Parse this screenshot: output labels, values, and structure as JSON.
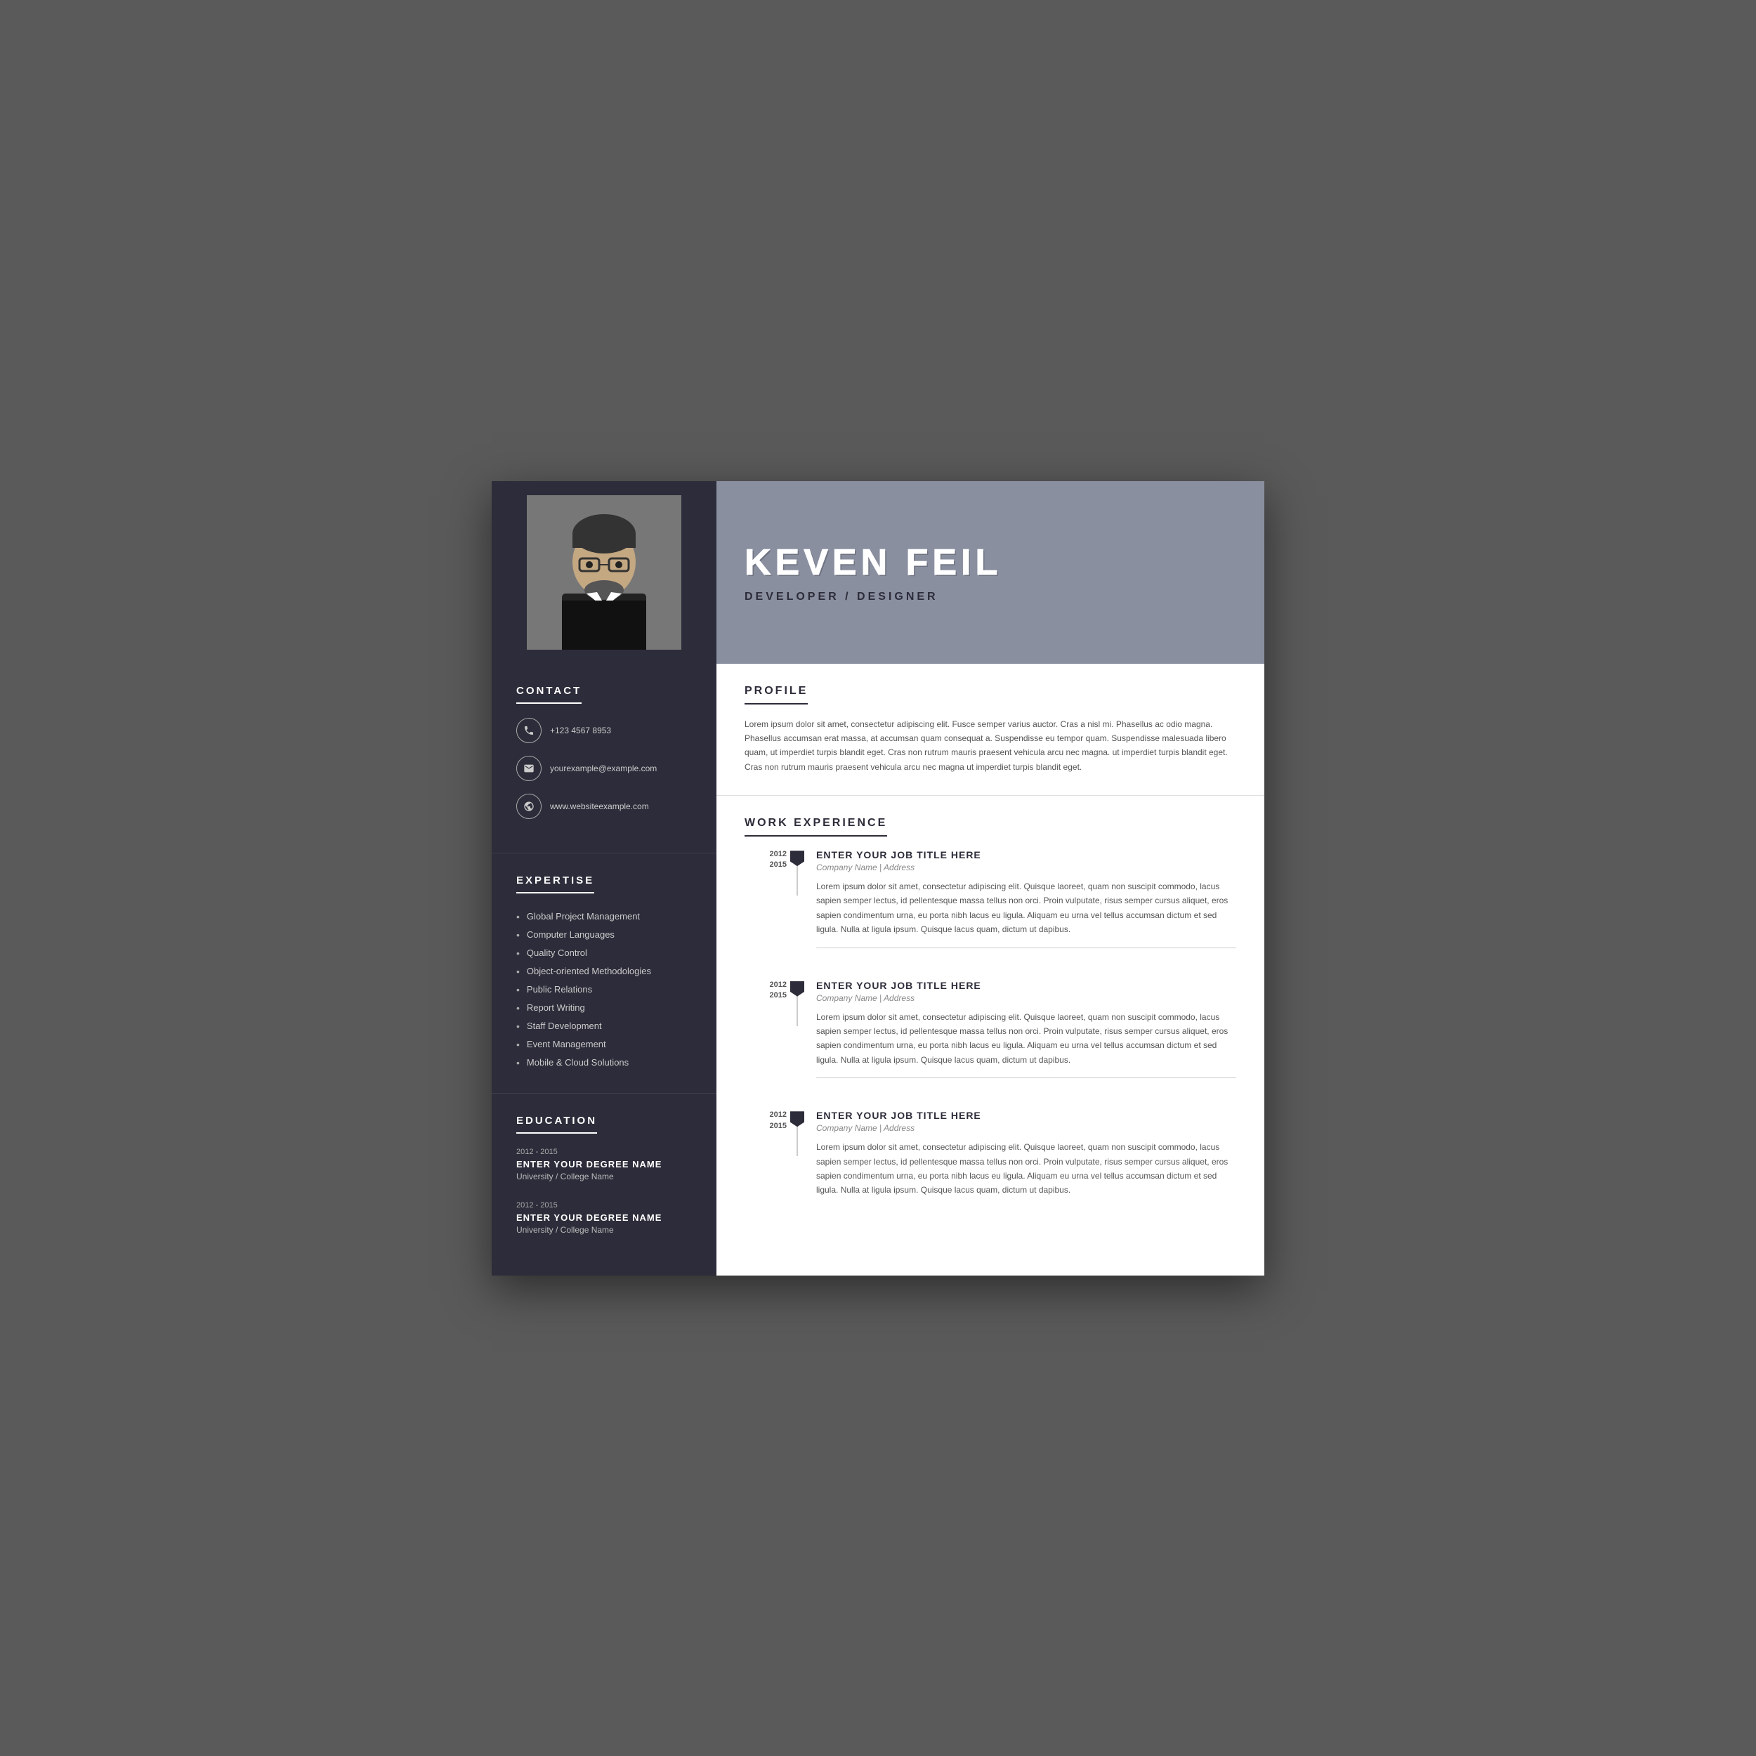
{
  "header": {
    "name": "KEVEN  FEIL",
    "title": "DEVELOPER / DESIGNER"
  },
  "contact": {
    "section_title": "CONTACT",
    "phone": "+123 4567 8953",
    "email": "yourexample@example.com",
    "website": "www.websiteexample.com"
  },
  "expertise": {
    "section_title": "EXPERTISE",
    "items": [
      "Global Project Management",
      "Computer Languages",
      "Quality Control",
      "Object-oriented Methodologies",
      "Public Relations",
      "Report Writing",
      "Staff Development",
      "Event Management",
      "Mobile & Cloud Solutions"
    ]
  },
  "education": {
    "section_title": "EDUCATION",
    "entries": [
      {
        "years": "2012 - 2015",
        "degree": "ENTER YOUR DEGREE NAME",
        "university": "University / College Name"
      },
      {
        "years": "2012 - 2015",
        "degree": "ENTER YOUR DEGREE NAME",
        "university": "University / College Name"
      }
    ]
  },
  "profile": {
    "section_title": "PROFILE",
    "text": "Lorem ipsum dolor sit amet, consectetur adipiscing elit. Fusce semper varius auctor. Cras a nisl mi. Phasellus ac odio magna. Phasellus accumsan erat massa, at accumsan quam consequat a. Suspendisse eu tempor quam. Suspendisse malesuada libero quam, ut imperdiet turpis blandit eget. Cras non rutrum mauris praesent vehicula arcu nec magna. ut imperdiet turpis blandit eget. Cras non rutrum mauris praesent vehicula arcu nec magna ut imperdiet turpis blandit eget."
  },
  "work_experience": {
    "section_title": "WORK EXPERIENCE",
    "jobs": [
      {
        "year_start": "2012",
        "year_end": "2015",
        "title": "ENTER YOUR JOB TITLE HERE",
        "company": "Company Name | Address",
        "description": "Lorem ipsum dolor sit amet, consectetur adipiscing elit. Quisque laoreet, quam non suscipit commodo, lacus sapien semper lectus, id pellentesque massa tellus non orci. Proin vulputate, risus semper cursus aliquet, eros sapien condimentum urna, eu porta nibh lacus eu ligula. Aliquam eu urna vel tellus accumsan dictum et sed ligula. Nulla at ligula ipsum. Quisque lacus quam, dictum ut dapibus."
      },
      {
        "year_start": "2012",
        "year_end": "2015",
        "title": "ENTER YOUR JOB TITLE HERE",
        "company": "Company Name | Address",
        "description": "Lorem ipsum dolor sit amet, consectetur adipiscing elit. Quisque laoreet, quam non suscipit commodo, lacus sapien semper lectus, id pellentesque massa tellus non orci. Proin vulputate, risus semper cursus aliquet, eros sapien condimentum urna, eu porta nibh lacus eu ligula. Aliquam eu urna vel tellus accumsan dictum et sed ligula. Nulla at ligula ipsum. Quisque lacus quam, dictum ut dapibus."
      },
      {
        "year_start": "2012",
        "year_end": "2015",
        "title": "ENTER YOUR JOB TITLE HERE",
        "company": "Company Name | Address",
        "description": "Lorem ipsum dolor sit amet, consectetur adipiscing elit. Quisque laoreet, quam non suscipit commodo, lacus sapien semper lectus, id pellentesque massa tellus non orci. Proin vulputate, risus semper cursus aliquet, eros sapien condimentum urna, eu porta nibh lacus eu ligula. Aliquam eu urna vel tellus accumsan dictum et sed ligula. Nulla at ligula ipsum. Quisque lacus quam, dictum ut dapibus."
      }
    ]
  }
}
